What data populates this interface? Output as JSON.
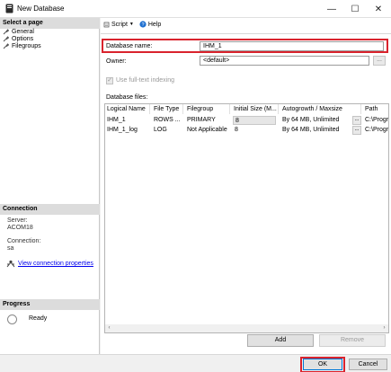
{
  "window": {
    "title": "New Database",
    "minimize": "—",
    "maximize": "☐",
    "close": "✕"
  },
  "left_panel": {
    "select_page_header": "Select a page",
    "pages": [
      {
        "label": "General"
      },
      {
        "label": "Options"
      },
      {
        "label": "Filegroups"
      }
    ],
    "connection_header": "Connection",
    "server_label": "Server:",
    "server_value": "ACOM18",
    "connection_label": "Connection:",
    "connection_value": "sa",
    "view_connection_properties": "View connection properties",
    "progress_header": "Progress",
    "progress_status": "Ready"
  },
  "toolbar": {
    "script_label": "Script",
    "help_label": "Help"
  },
  "form": {
    "database_name_label": "Database name:",
    "database_name_value": "IHM_1",
    "owner_label": "Owner:",
    "owner_value": "<default>",
    "owner_browse": "...",
    "fulltext_label": "Use full-text indexing",
    "fulltext_checked": true
  },
  "database_files": {
    "group_label": "Database files:",
    "columns": [
      "Logical Name",
      "File Type",
      "Filegroup",
      "Initial Size (M...",
      "Autogrowth / Maxsize",
      "Path"
    ],
    "rows": [
      {
        "logical_name": "IHM_1",
        "file_type": "ROWS ...",
        "filegroup": "PRIMARY",
        "initial_size": "8",
        "autogrowth": "By 64 MB, Unlimited",
        "browse": "...",
        "path": "C:\\Progra"
      },
      {
        "logical_name": "IHM_1_log",
        "file_type": "LOG",
        "filegroup": "Not Applicable",
        "initial_size": "8",
        "autogrowth": "By 64 MB, Unlimited",
        "browse": "...",
        "path": "C:\\Progra"
      }
    ],
    "scroll_left": "‹",
    "scroll_right": "›"
  },
  "buttons": {
    "add": "Add",
    "remove": "Remove",
    "ok": "OK",
    "cancel": "Cancel"
  },
  "colors": {
    "highlight_red": "#d9232d",
    "link_blue": "#0000ee"
  }
}
